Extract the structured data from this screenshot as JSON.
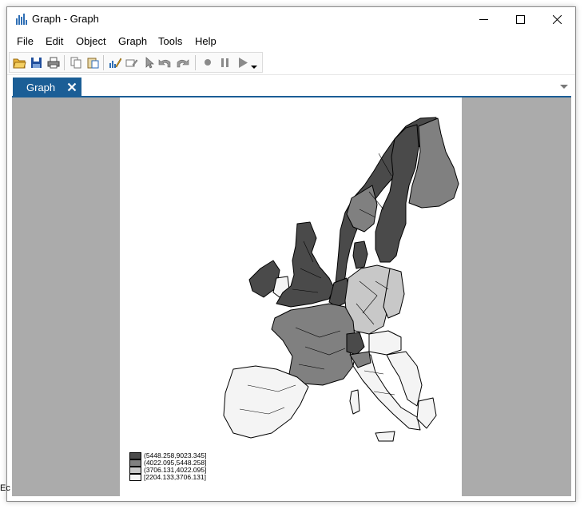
{
  "window": {
    "title": "Graph - Graph"
  },
  "menu": [
    "File",
    "Edit",
    "Object",
    "Graph",
    "Tools",
    "Help"
  ],
  "toolbar": {
    "buttons": [
      "open-icon",
      "save-icon",
      "print-icon",
      "copy-icon",
      "paste-icon",
      "graph-editor-icon",
      "rename-icon",
      "pointer-icon",
      "undo-icon",
      "redo-icon",
      "record-icon",
      "pause-icon",
      "play-icon"
    ]
  },
  "tabs": [
    {
      "label": "Graph"
    }
  ],
  "legend": {
    "entries": [
      {
        "label": "(5448.258,9023.345]",
        "color": "#4a4a4a"
      },
      {
        "label": "(4022.095,5448.258]",
        "color": "#808080"
      },
      {
        "label": "(3706.131,4022.095]",
        "color": "#c8c8c8"
      },
      {
        "label": "[2204.133,3706.131]",
        "color": "#f4f4f4"
      }
    ]
  },
  "colors": {
    "accent": "#1b5e96",
    "canvas_bg": "#ababab",
    "class_dark": "#4a4a4a",
    "class_mid": "#808080",
    "class_light": "#c8c8c8",
    "class_lightest": "#f4f4f4"
  },
  "edge_text": "Ec"
}
